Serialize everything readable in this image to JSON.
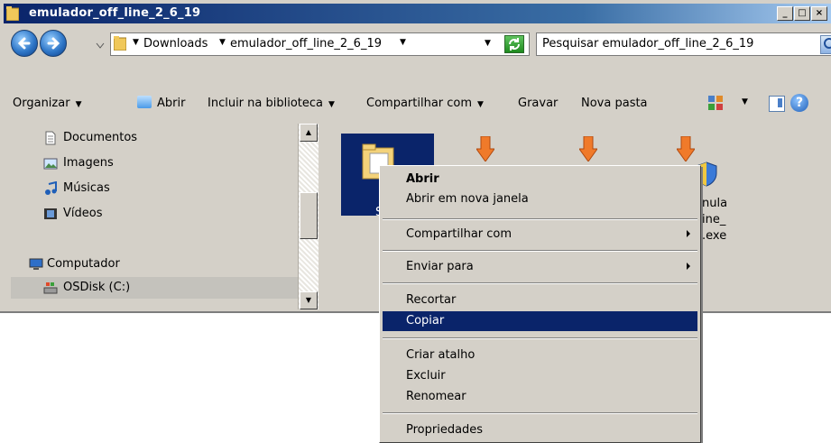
{
  "window": {
    "title": "emulador_off_line_2_6_19"
  },
  "address_bar": {
    "crumbs": [
      "Downloads",
      "emulador_off_line_2_6_19"
    ],
    "search_placeholder": "Pesquisar emulador_off_line_2_6_19"
  },
  "toolbar": {
    "organize": "Organizar",
    "open": "Abrir",
    "include_library": "Incluir na biblioteca",
    "share_with": "Compartilhar com",
    "burn": "Gravar",
    "new_folder": "Nova pasta"
  },
  "nav_pane": {
    "items": [
      {
        "label": "Documentos",
        "icon": "document-icon"
      },
      {
        "label": "Imagens",
        "icon": "image-icon"
      },
      {
        "label": "Músicas",
        "icon": "music-icon"
      },
      {
        "label": "Vídeos",
        "icon": "video-icon"
      },
      {
        "label": "Computador",
        "icon": "computer-icon"
      },
      {
        "label": "OSDisk (C:)",
        "icon": "drive-icon"
      }
    ]
  },
  "content": {
    "selected_folder_label_fragment": "S",
    "exe_label_lines": [
      "nula",
      "ine_",
      ".exe"
    ]
  },
  "context_menu": {
    "items": [
      {
        "label": "Abrir",
        "bold": true
      },
      {
        "label": "Abrir em nova janela"
      },
      {
        "label": "Compartilhar com",
        "submenu": true
      },
      {
        "label": "Enviar para",
        "submenu": true
      },
      {
        "label": "Recortar"
      },
      {
        "label": "Copiar",
        "highlighted": true
      },
      {
        "label": "Criar atalho"
      },
      {
        "label": "Excluir"
      },
      {
        "label": "Renomear"
      },
      {
        "label": "Propriedades"
      }
    ]
  },
  "colors": {
    "title_bar": "#0a246a",
    "selection": "#0a246a",
    "window_face": "#d4d0c8"
  }
}
